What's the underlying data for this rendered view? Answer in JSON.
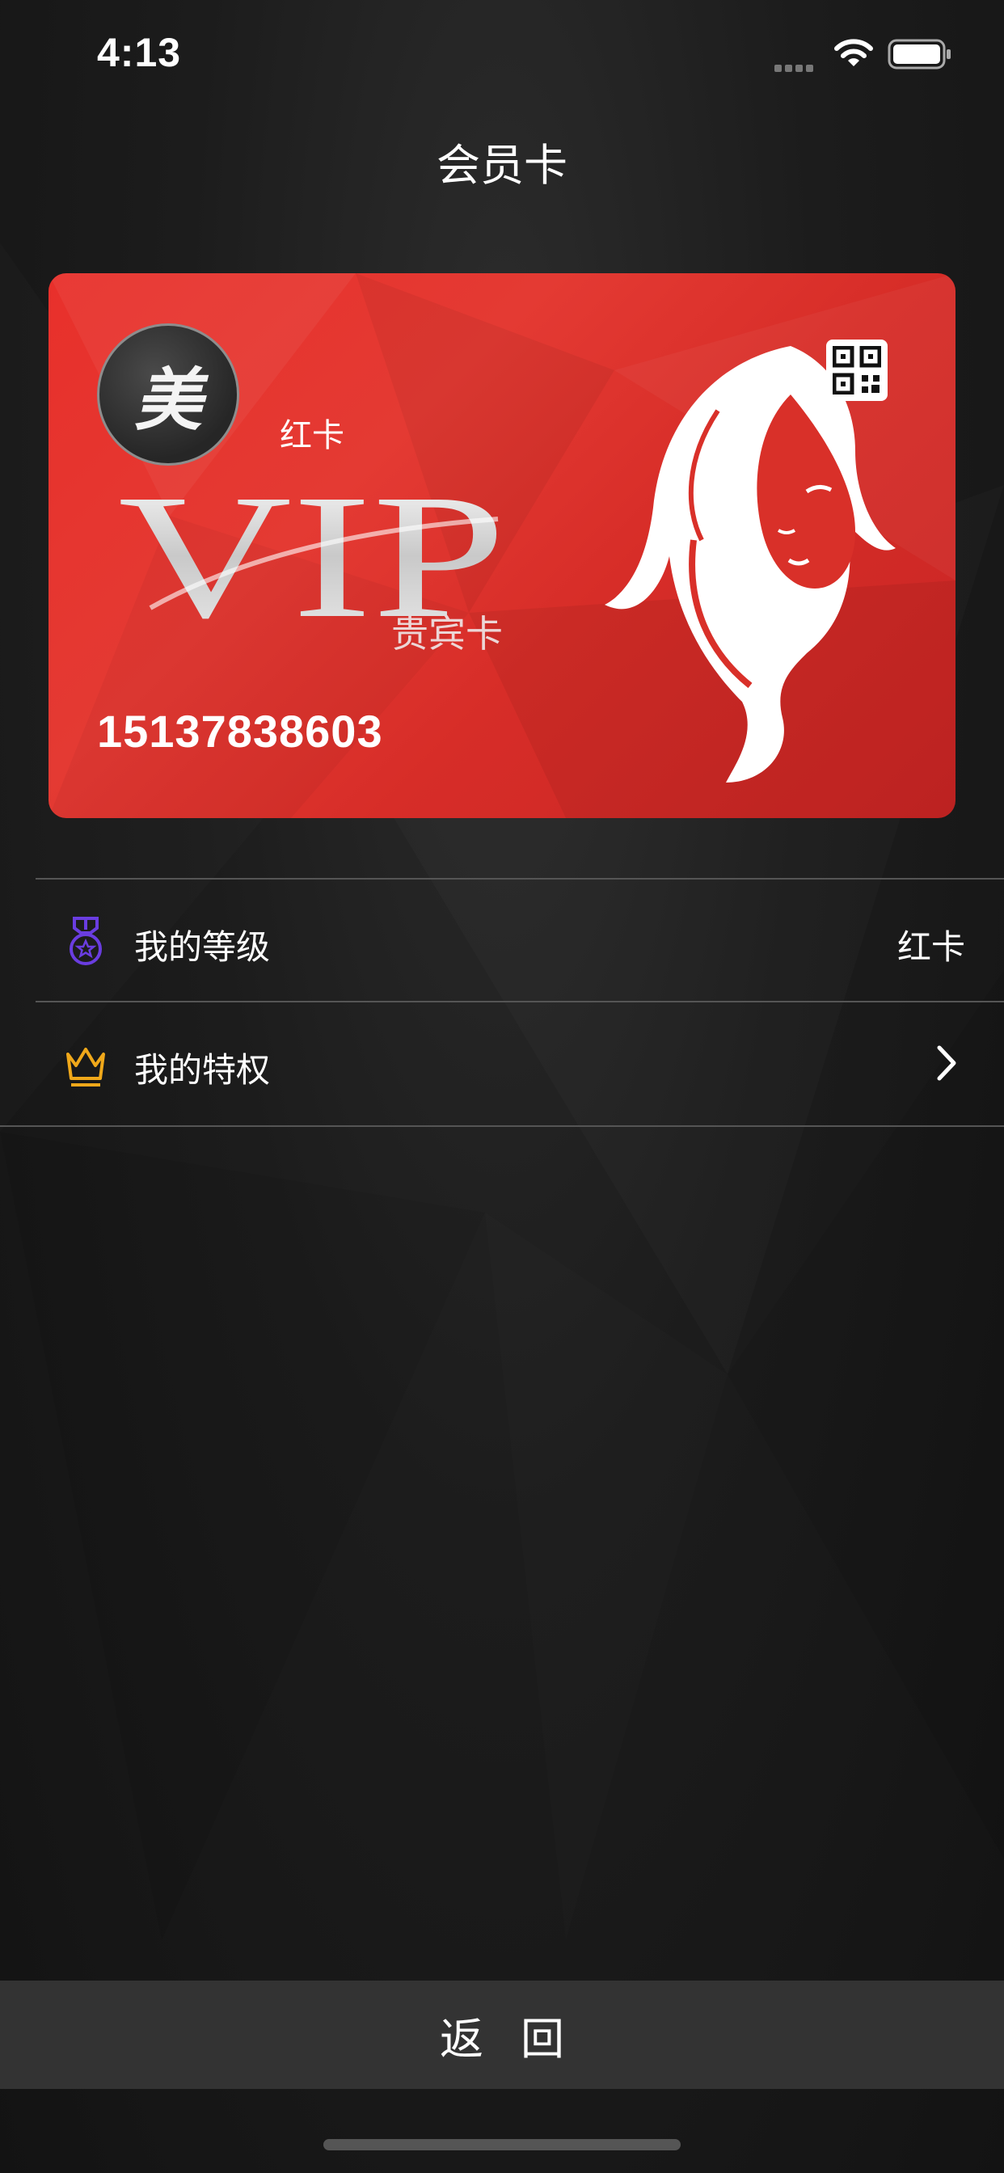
{
  "status_bar": {
    "time": "4:13"
  },
  "nav": {
    "title": "会员卡"
  },
  "card": {
    "brand_logo_text": "美",
    "level": "红卡",
    "vip_word": "VIP",
    "vip_sub": "贵宾卡",
    "number": "15137838603"
  },
  "list": [
    {
      "label": "我的等级",
      "value": "红卡",
      "icon": "medal-icon"
    },
    {
      "label": "我的特权",
      "icon": "crown-icon"
    }
  ],
  "footer": {
    "back_label": "返回"
  },
  "colors": {
    "card_red": "#e43a33",
    "medal": "#6a3de0",
    "crown": "#f0a81a",
    "back_bar": "#333333"
  }
}
